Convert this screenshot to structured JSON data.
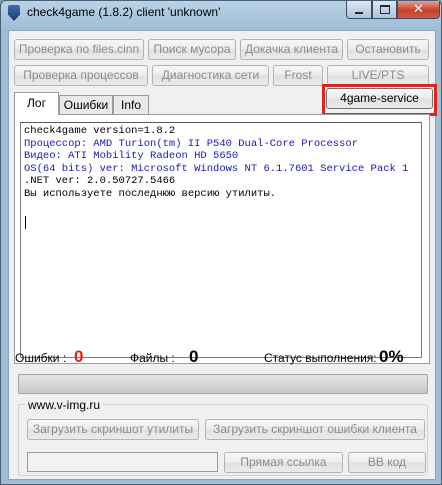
{
  "window": {
    "title": "check4game (1.8.2) client 'unknown'"
  },
  "buttons": {
    "check_files": "Проверка по files.cinn",
    "find_garbage": "Поиск мусора",
    "download_client": "Докачка клиента",
    "stop": "Остановить",
    "check_processes": "Проверка процессов",
    "network_diag": "Диагностика сети",
    "frost": "Frost",
    "live_pts": "LIVE/PTS",
    "service": "4game-service"
  },
  "tabs": [
    "Лог",
    "Ошибки",
    "Info"
  ],
  "log": {
    "lines": [
      "check4game version=1.8.2",
      "Процессор: AMD Turion(tm) II P540 Dual-Core Processor",
      "Видео: ATI Mobility Radeon HD 5650",
      "OS(64 bits) ver: Microsoft Windows NT 6.1.7601 Service Pack 1",
      ".NET ver: 2.0.50727.5466",
      "Вы используете последнюю версию утилиты."
    ],
    "blue_color": "#1b1bb4"
  },
  "stats": {
    "errors_label": "Ошибки :",
    "errors_value": "0",
    "errors_color": "#e0231d",
    "files_label": "Файлы :",
    "files_value": "0",
    "status_label": "Статус выполнения:",
    "status_value": "0%",
    "progress_fraction": 0
  },
  "upload": {
    "group_label": "www.v-img.ru",
    "upload_screenshot": "Загрузить скриншот утилиты",
    "upload_error_screenshot": "Загрузить скриншот ошибки клиента",
    "link_value": "",
    "direct_link": "Прямая ссылка",
    "bb_code": "BB код"
  }
}
